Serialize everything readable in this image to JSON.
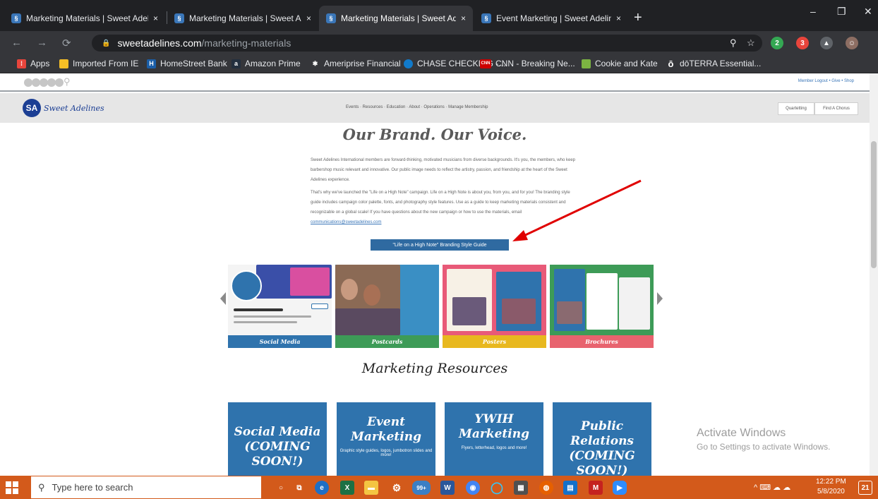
{
  "browser": {
    "tabs": [
      {
        "title": "Marketing Materials | Sweet Adel",
        "active": false
      },
      {
        "title": "Marketing Materials | Sweet Adel",
        "active": false
      },
      {
        "title": "Marketing Materials | Sweet Adel",
        "active": true
      },
      {
        "title": "Event Marketing | Sweet Adelines",
        "active": false
      }
    ],
    "tab_close": "×",
    "new_tab": "+",
    "window_controls": {
      "minimize": "–",
      "restore": "❐",
      "close": "✕"
    },
    "nav": {
      "back": "←",
      "forward": "→",
      "reload": "⟳"
    },
    "address": {
      "lock": "🔒",
      "host": "sweetadelines.com",
      "path": "/marketing-materials"
    },
    "omnibox_icons": {
      "zoom": "⚲",
      "star": "☆"
    },
    "extensions": [
      {
        "label": "2",
        "color": "#34a853"
      },
      {
        "label": "3",
        "color": "#e8453c"
      },
      {
        "label": "▲",
        "color": "#5f6368"
      },
      {
        "label": "☺",
        "color": "#8d6e63"
      }
    ],
    "bookmarks": [
      {
        "label": "Apps",
        "icon": "apps-grid-icon",
        "glyph": "⁞",
        "color": "#e8453c"
      },
      {
        "label": "Imported From IE",
        "icon": "folder-icon",
        "glyph": "",
        "color": "#f6bf26"
      },
      {
        "label": "HomeStreet Bank",
        "icon": "homestreet-icon",
        "glyph": "H",
        "color": "#1a5ea8"
      },
      {
        "label": "Amazon Prime",
        "icon": "amazon-icon",
        "glyph": "a",
        "color": "#232f3e"
      },
      {
        "label": "Ameriprise Financial",
        "icon": "ameriprise-icon",
        "glyph": "✱",
        "color": "#35363a"
      },
      {
        "label": "CHASE CHECKING -...",
        "icon": "chase-icon",
        "glyph": "",
        "color": "#117aca"
      },
      {
        "label": "CNN - Breaking Ne...",
        "icon": "cnn-icon",
        "glyph": "CNN",
        "color": "#cc0000"
      },
      {
        "label": "Cookie and Kate",
        "icon": "cookie-kate-icon",
        "glyph": "",
        "color": "#7cb342"
      },
      {
        "label": "dōTERRA Essential...",
        "icon": "doterra-icon",
        "glyph": "ō",
        "color": "#35363a"
      }
    ]
  },
  "site": {
    "search_glyph": "⚲",
    "member_links": "Member Logout  •  Give  •  Shop",
    "logo_mark": "SA",
    "logo_text": "Sweet Adelines",
    "nav_links": "Events  ·  Resources  ·  Education  ·  About  ·  Operations  ·  Manage Membership",
    "nav_buttons": [
      "Quartetting",
      "Find A Chorus"
    ],
    "heading": "Our Brand. Our Voice.",
    "para1": "Sweet Adelines International members are forward-thinking, motivated musicians from diverse backgrounds. It's you, the members, who keep barbershop music relevant and innovative. Our public image needs to reflect the artistry, passion, and friendship at the heart of the Sweet Adelines experience.",
    "para2": "That's why we've launched the \"Life on a High Note\" campaign. Life on a High Note is about you, from you, and for you! The branding style guide includes campaign color palette, fonts, and photography style features. Use as a guide to keep marketing materials consistent and recognizable on a global scale! If you have questions about the new campaign or how to use the materials, email",
    "email": "communications@sweetadelines.com",
    "style_guide_button": "\"Life on a High Note\" Branding Style Guide",
    "cards": [
      {
        "label": "Social Media",
        "color": "#2f73ad"
      },
      {
        "label": "Postcards",
        "color": "#3d9b57"
      },
      {
        "label": "Posters",
        "color": "#e8b81e"
      },
      {
        "label": "Brochures",
        "color": "#e8636e"
      }
    ],
    "marketing_resources_heading": "Marketing Resources",
    "tiles": [
      {
        "title": "Social Media (COMING SOON!)",
        "subtitle": ""
      },
      {
        "title": "Event Marketing",
        "subtitle": "Graphic style guides, logos, jumbotron slides and more!"
      },
      {
        "title": "YWIH Marketing",
        "subtitle": "Flyers, letterhead, logos and more!"
      },
      {
        "title": "Public Relations (COMING SOON!)",
        "subtitle": ""
      }
    ]
  },
  "watermark": {
    "line1": "Activate Windows",
    "line2": "Go to Settings to activate Windows."
  },
  "taskbar": {
    "search_placeholder": "Type here to search",
    "search_glyph": "⚲",
    "apps": [
      {
        "name": "cortana-icon",
        "glyph": "○",
        "color": "transparent"
      },
      {
        "name": "task-view-icon",
        "glyph": "⧉",
        "color": "transparent"
      },
      {
        "name": "edge-icon",
        "glyph": "e",
        "color": "#1f6fc5"
      },
      {
        "name": "excel-icon",
        "glyph": "X",
        "color": "#1d7044"
      },
      {
        "name": "file-explorer-icon",
        "glyph": "▬",
        "color": "#f4c542"
      },
      {
        "name": "settings-icon",
        "glyph": "⚙",
        "color": "transparent"
      },
      {
        "name": "mail-badge-icon",
        "glyph": "99+",
        "color": "#3b7fc4"
      },
      {
        "name": "word-icon",
        "glyph": "W",
        "color": "#2b579a"
      },
      {
        "name": "chrome-icon",
        "glyph": "◉",
        "color": "#4285f4"
      },
      {
        "name": "cortana-ring-icon",
        "glyph": "◯",
        "color": "transparent"
      },
      {
        "name": "calculator-icon",
        "glyph": "▦",
        "color": "#505050"
      },
      {
        "name": "firefox-icon",
        "glyph": "◍",
        "color": "#e66000"
      },
      {
        "name": "news-icon",
        "glyph": "▤",
        "color": "#1470c9"
      },
      {
        "name": "gmail-icon",
        "glyph": "M",
        "color": "#c5221f"
      },
      {
        "name": "zoom-icon",
        "glyph": "▶",
        "color": "#2d8cff"
      }
    ],
    "tray": "^  ⌨  ☁  ☁",
    "time": "12:22 PM",
    "date": "5/8/2020",
    "notify": "21"
  }
}
